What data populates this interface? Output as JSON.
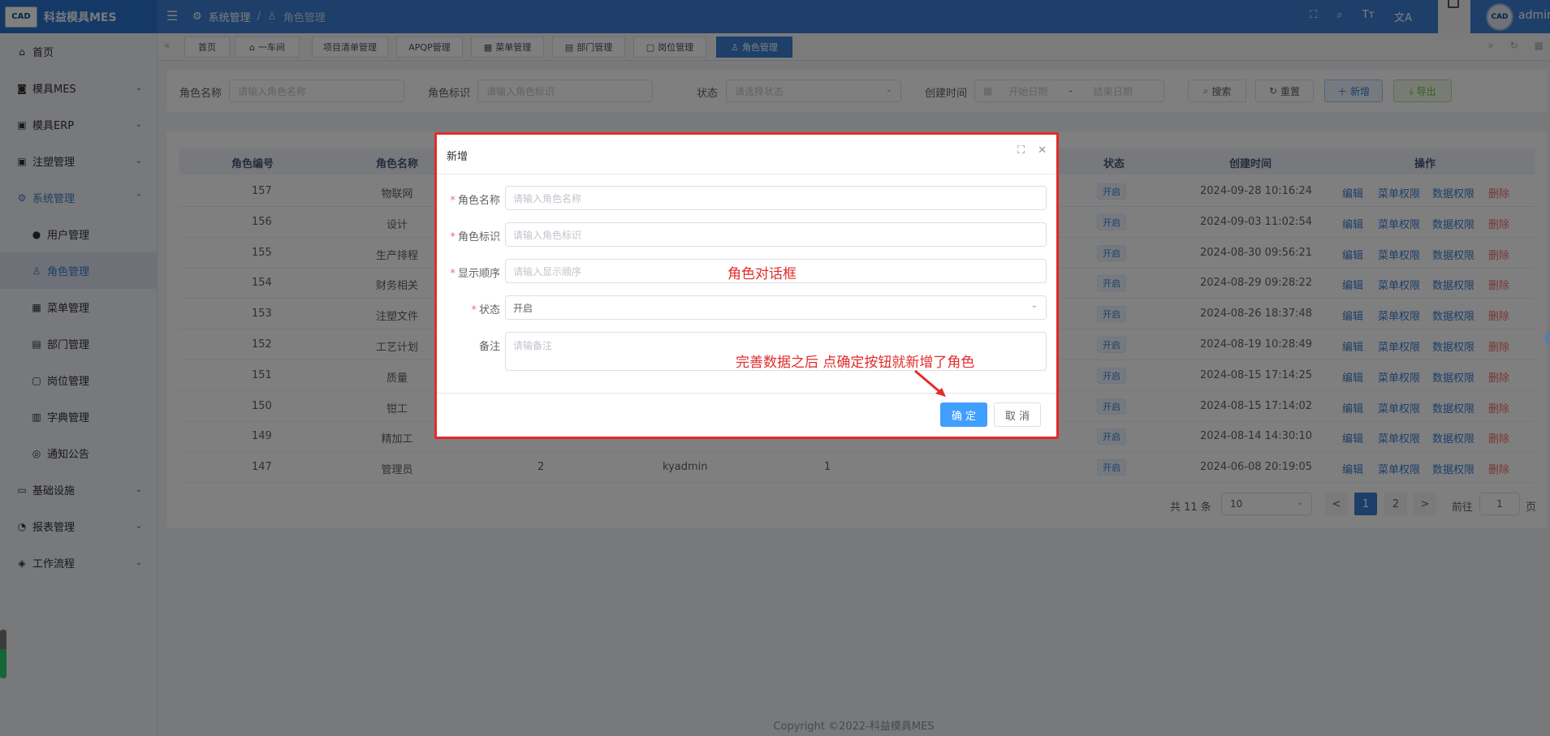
{
  "header": {
    "logo": "CAD",
    "app_title": "科益模具MES",
    "breadcrumb": [
      "系统管理",
      "/",
      "角色管理"
    ],
    "username": "admin",
    "avatar_text": "CAD",
    "icons": [
      "fullscreen-icon",
      "search-icon",
      "font-size-icon",
      "translate-icon"
    ],
    "icon_glyphs": [
      "⛶",
      "⌕",
      "Tт",
      "文A"
    ]
  },
  "sidebar": {
    "items": [
      {
        "label": "首页",
        "icon": "home-icon"
      },
      {
        "label": "模具MES",
        "icon": "camera-icon",
        "arrow": "⌄"
      },
      {
        "label": "模具ERP",
        "icon": "briefcase-icon",
        "arrow": "⌄"
      },
      {
        "label": "注塑管理",
        "icon": "briefcase-icon",
        "arrow": "⌄"
      },
      {
        "label": "系统管理",
        "icon": "gear-icon",
        "arrow": "⌃"
      }
    ],
    "sub_items": [
      {
        "label": "用户管理",
        "icon": "user-icon"
      },
      {
        "label": "角色管理",
        "icon": "user-outline-icon"
      },
      {
        "label": "菜单管理",
        "icon": "grid-icon"
      },
      {
        "label": "部门管理",
        "icon": "id-card-icon"
      },
      {
        "label": "岗位管理",
        "icon": "badge-icon"
      },
      {
        "label": "字典管理",
        "icon": "book-icon"
      },
      {
        "label": "通知公告",
        "icon": "message-icon"
      }
    ],
    "bottom_items": [
      {
        "label": "基础设施",
        "icon": "monitor-icon",
        "arrow": "⌄"
      },
      {
        "label": "报表管理",
        "icon": "chart-icon",
        "arrow": "⌄"
      },
      {
        "label": "工作流程",
        "icon": "flow-icon",
        "arrow": "⌄"
      }
    ]
  },
  "tabs": [
    "首页",
    "一车间",
    "项目清单管理",
    "APQP管理",
    "菜单管理",
    "部门管理",
    "岗位管理",
    "角色管理"
  ],
  "search": {
    "role_name_label": "角色名称",
    "role_name_placeholder": "请输入角色名称",
    "role_key_label": "角色标识",
    "role_key_placeholder": "请输入角色标识",
    "status_label": "状态",
    "status_placeholder": "请选择状态",
    "created_label": "创建时间",
    "start_placeholder": "开始日期",
    "date_sep": "-",
    "end_placeholder": "结束日期",
    "search_btn": "搜索",
    "reset_btn": "重置",
    "add_btn": "新增",
    "export_btn": "导出"
  },
  "table": {
    "headers": [
      "角色编号",
      "角色名称",
      "状态",
      "创建时间",
      "操作"
    ],
    "rows": [
      {
        "id": "157",
        "name": "物联网",
        "status": "开启",
        "created": "2024-09-28 10:16:24"
      },
      {
        "id": "156",
        "name": "设计",
        "status": "开启",
        "created": "2024-09-03 11:02:54"
      },
      {
        "id": "155",
        "name": "生产排程",
        "status": "开启",
        "created": "2024-08-30 09:56:21"
      },
      {
        "id": "154",
        "name": "财务相关",
        "status": "开启",
        "created": "2024-08-29 09:28:22"
      },
      {
        "id": "153",
        "name": "注塑文件",
        "status": "开启",
        "created": "2024-08-26 18:37:48"
      },
      {
        "id": "152",
        "name": "工艺计划",
        "status": "开启",
        "created": "2024-08-19 10:28:49"
      },
      {
        "id": "151",
        "name": "质量",
        "status": "开启",
        "created": "2024-08-15 17:14:25"
      },
      {
        "id": "150",
        "name": "钳工",
        "status": "开启",
        "created": "2024-08-15 17:14:02"
      },
      {
        "id": "149",
        "name": "精加工",
        "status": "开启",
        "created": "2024-08-14 14:30:10"
      },
      {
        "id": "147",
        "name": "管理员",
        "sort": "2",
        "key": "kyadmin",
        "scope": "1",
        "status": "开启",
        "created": "2024-06-08 20:19:05"
      }
    ],
    "ops": [
      "编辑",
      "菜单权限",
      "数据权限",
      "删除"
    ]
  },
  "pagination": {
    "total": "共 11 条",
    "page_size": "10",
    "pages": [
      "1",
      "2"
    ],
    "goto_label": "前往",
    "goto_value": "1",
    "page_suffix": "页",
    "prev": "<",
    "next": ">"
  },
  "footer": "Copyright ©2022-科益模具MES",
  "dialog": {
    "title": "新增",
    "fields": [
      {
        "label": "角色名称",
        "required": true,
        "placeholder": "请输入角色名称"
      },
      {
        "label": "角色标识",
        "required": true,
        "placeholder": "请输入角色标识"
      },
      {
        "label": "显示顺序",
        "required": true,
        "placeholder": "请输入显示顺序"
      },
      {
        "label": "状态",
        "required": true,
        "value": "开启"
      },
      {
        "label": "备注",
        "required": false,
        "placeholder": "请输备注"
      }
    ],
    "ok_btn": "确 定",
    "cancel_btn": "取 消"
  },
  "annotations": {
    "dialog_note": "角色对话框",
    "confirm_note": "完善数据之后 点确定按钮就新增了角色"
  },
  "colors": {
    "primary": "#3b7fd3",
    "danger": "#f56c6c",
    "annotation": "#e22b2b"
  }
}
